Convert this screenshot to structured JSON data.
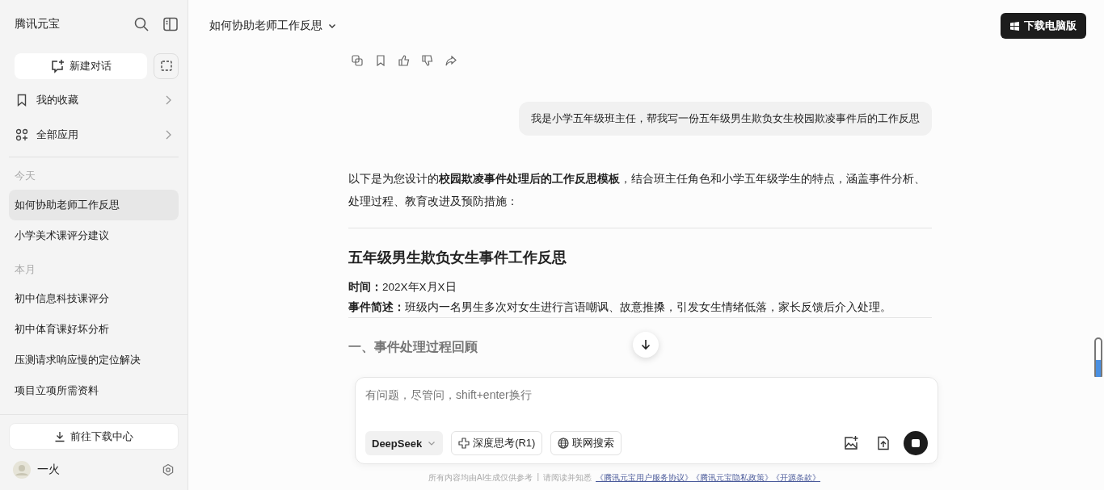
{
  "sidebar": {
    "app_name": "腾讯元宝",
    "new_chat": "新建对话",
    "nav": [
      {
        "kind": "bookmark",
        "label": "我的收藏"
      },
      {
        "kind": "apps",
        "label": "全部应用"
      }
    ],
    "history": [
      {
        "group": "今天",
        "items": [
          {
            "label": "如何协助老师工作反思",
            "selected": true
          },
          {
            "label": "小学美术课评分建议",
            "selected": false
          }
        ]
      },
      {
        "group": "本月",
        "items": [
          {
            "label": "初中信息科技课评分",
            "selected": false
          },
          {
            "label": "初中体育课好坏分析",
            "selected": false
          },
          {
            "label": "压测请求响应慢的定位解决",
            "selected": false
          },
          {
            "label": "项目立项所需资料",
            "selected": false
          }
        ]
      }
    ],
    "download_center": "前往下载中心",
    "user": {
      "name": "一火"
    }
  },
  "header": {
    "title": "如何协助老师工作反思",
    "download_button": "下载电脑版"
  },
  "chat": {
    "user_message": "我是小学五年级班主任，帮我写一份五年级男生欺负女生校园欺凌事件后的工作反思",
    "answer": {
      "intro": "以下是为您设计的**校园欺凌事件处理后的工作反思模板**，结合班主任角色和小学五年级学生的特点，涵盖事件分析、处理过程、教育改进及预防措施：",
      "heading": "五年级男生欺负女生事件工作反思",
      "fields": [
        {
          "label": "时间：",
          "value": "202X年X月X日"
        },
        {
          "label": "事件简述：",
          "value": "班级内一名男生多次对女生进行言语嘲讽、故意推搡，引发女生情绪低落，家长反馈后介入处理。"
        }
      ],
      "section_heading": "一、事件处理过程回顾"
    }
  },
  "composer": {
    "placeholder": "有问题，尽管问，shift+enter换行",
    "model": "DeepSeek",
    "toggles": [
      {
        "kind": "think",
        "label": "深度思考(R1)"
      },
      {
        "kind": "web",
        "label": "联网搜索"
      }
    ]
  },
  "footer": {
    "note": "所有内容均由AI生成仅供参考",
    "separator": "|",
    "prefix": "请阅读并知悉",
    "links": [
      "《腾讯元宝用户服务协议》",
      "《腾讯元宝隐私政策》",
      "《开源条款》"
    ]
  }
}
